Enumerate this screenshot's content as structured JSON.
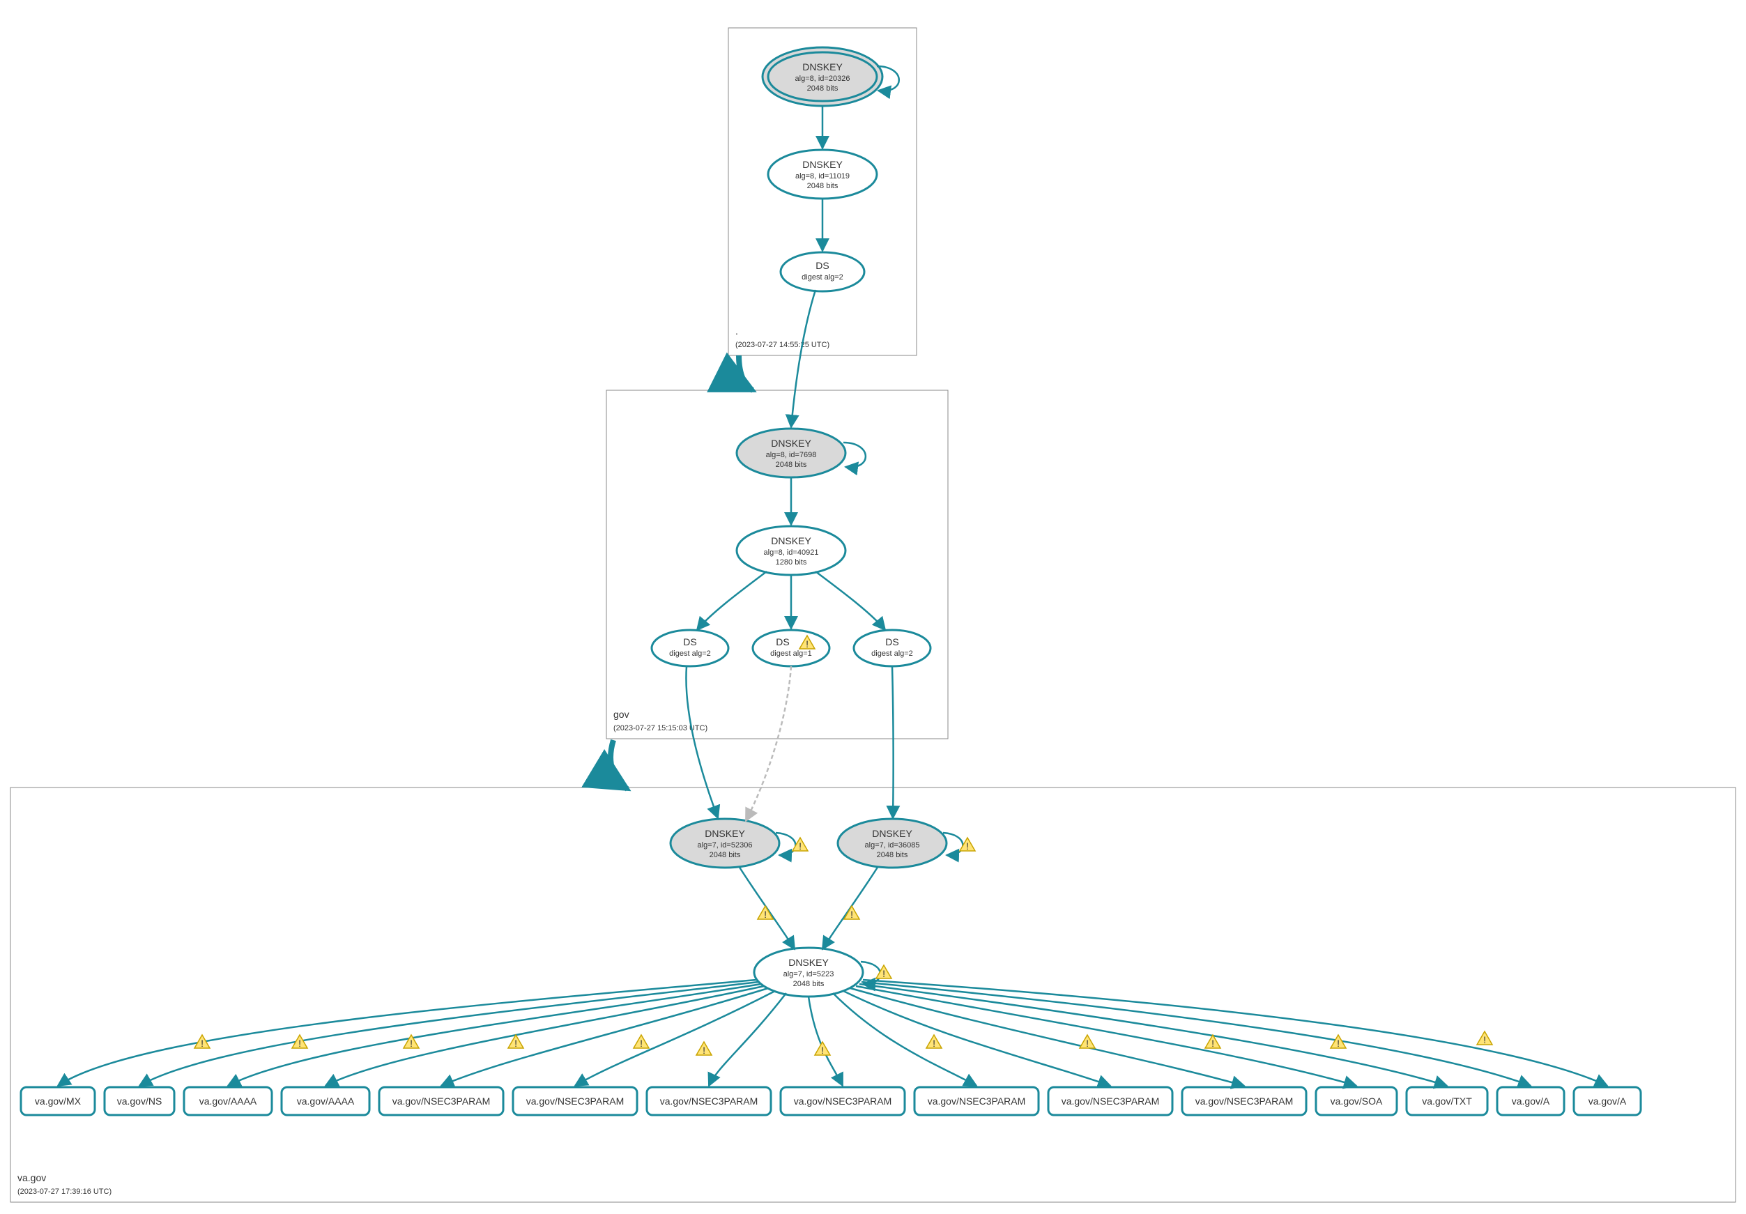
{
  "zones": {
    "root": {
      "label": ".",
      "timestamp": "(2023-07-27 14:55:25 UTC)"
    },
    "gov": {
      "label": "gov",
      "timestamp": "(2023-07-27 15:15:03 UTC)"
    },
    "vagov": {
      "label": "va.gov",
      "timestamp": "(2023-07-27 17:39:16 UTC)"
    }
  },
  "nodes": {
    "root_ksk": {
      "title": "DNSKEY",
      "line2": "alg=8, id=20326",
      "line3": "2048 bits"
    },
    "root_zsk": {
      "title": "DNSKEY",
      "line2": "alg=8, id=11019",
      "line3": "2048 bits"
    },
    "root_ds": {
      "title": "DS",
      "line2": "digest alg=2"
    },
    "gov_ksk": {
      "title": "DNSKEY",
      "line2": "alg=8, id=7698",
      "line3": "2048 bits"
    },
    "gov_zsk": {
      "title": "DNSKEY",
      "line2": "alg=8, id=40921",
      "line3": "1280 bits"
    },
    "gov_ds1": {
      "title": "DS",
      "line2": "digest alg=2"
    },
    "gov_ds2": {
      "title": "DS",
      "line2": "digest alg=1"
    },
    "gov_ds3": {
      "title": "DS",
      "line2": "digest alg=2"
    },
    "va_ksk1": {
      "title": "DNSKEY",
      "line2": "alg=7, id=52306",
      "line3": "2048 bits"
    },
    "va_ksk2": {
      "title": "DNSKEY",
      "line2": "alg=7, id=36085",
      "line3": "2048 bits"
    },
    "va_zsk": {
      "title": "DNSKEY",
      "line2": "alg=7, id=5223",
      "line3": "2048 bits"
    },
    "rr0": "va.gov/MX",
    "rr1": "va.gov/NS",
    "rr2": "va.gov/AAAA",
    "rr3": "va.gov/AAAA",
    "rr4": "va.gov/NSEC3PARAM",
    "rr5": "va.gov/NSEC3PARAM",
    "rr6": "va.gov/NSEC3PARAM",
    "rr7": "va.gov/NSEC3PARAM",
    "rr8": "va.gov/NSEC3PARAM",
    "rr9": "va.gov/NSEC3PARAM",
    "rr10": "va.gov/NSEC3PARAM",
    "rr11": "va.gov/SOA",
    "rr12": "va.gov/TXT",
    "rr13": "va.gov/A",
    "rr14": "va.gov/A"
  },
  "warn_glyph": "⚠"
}
